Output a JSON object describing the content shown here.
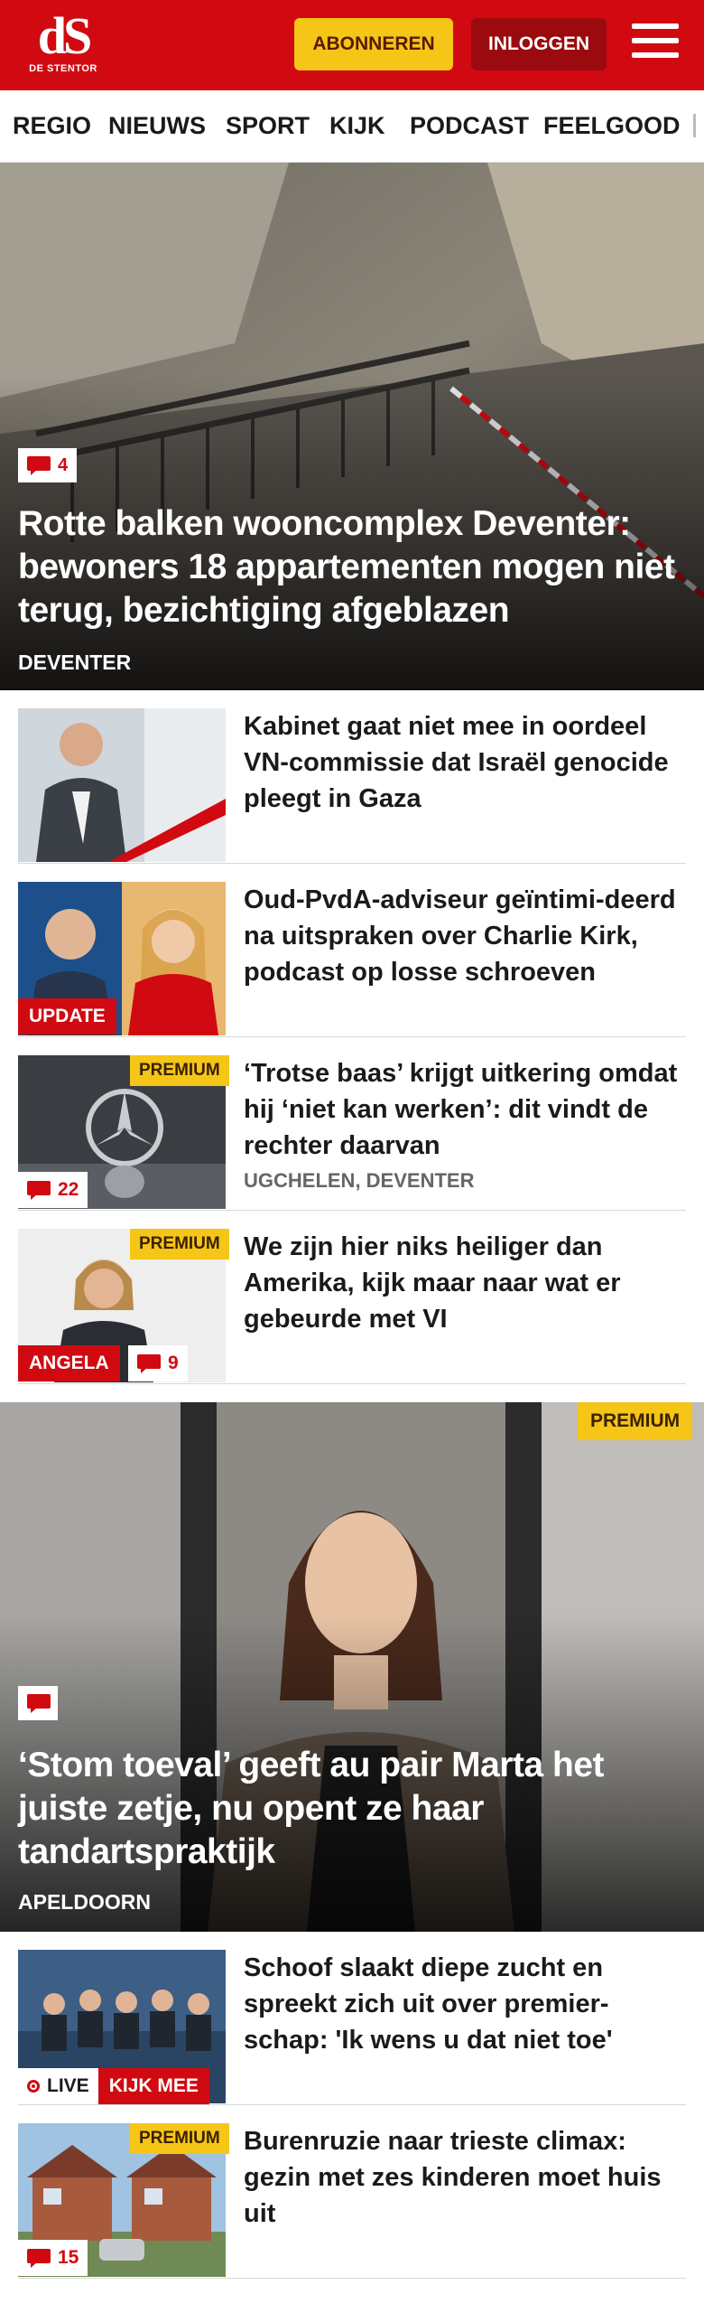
{
  "header": {
    "logo_mark": "dS",
    "logo_sub": "DE STENTOR",
    "subscribe_label": "ABONNEREN",
    "login_label": "INLOGGEN"
  },
  "nav": {
    "items": [
      "REGIO",
      "NIEUWS",
      "SPORT",
      "KIJK",
      "PODCAST",
      "FEELGOOD"
    ]
  },
  "hero1": {
    "comments": "4",
    "title": "Rotte balken wooncomplex Deventer: bewoners 18 appartementen mogen niet terug, bezichtiging afgeblazen",
    "category": "DEVENTER"
  },
  "articles": [
    {
      "title": "Kabinet gaat niet mee in oordeel VN-commissie dat Israël genocide pleegt in Gaza"
    },
    {
      "title": "Oud-PvdA-adviseur geïntimi-deerd na uitspraken over Charlie Kirk, podcast op losse schroeven",
      "label": "UPDATE"
    },
    {
      "title": "‘Trotse baas’ krijgt uitkering omdat hij ‘niet kan werken’: dit vindt de rechter daarvan",
      "category": "UGCHELEN, DEVENTER",
      "premium": "PREMIUM",
      "comments": "22"
    },
    {
      "title": "We zijn hier niks heiliger dan Amerika, kijk maar naar wat er gebeurde met VI",
      "premium": "PREMIUM",
      "label": "ANGELA",
      "comments": "9"
    }
  ],
  "hero2": {
    "premium": "PREMIUM",
    "title": "‘Stom toeval’ geeft au pair Marta het juiste zetje, nu opent ze haar tandartspraktijk",
    "category": "APELDOORN"
  },
  "articles2": [
    {
      "title": "Schoof slaakt diepe zucht en spreekt zich uit over premier-schap: 'Ik wens u dat niet toe'",
      "live": "LIVE",
      "watch": "KIJK MEE"
    },
    {
      "title": "Burenruzie naar trieste climax: gezin met zes kinderen moet huis uit",
      "premium": "PREMIUM",
      "comments": "15"
    }
  ],
  "colors": {
    "brand_red": "#d10a11",
    "premium_yellow": "#f5c518",
    "login_dark_red": "#9b0a0e"
  },
  "icons": [
    "menu-icon",
    "comment-icon",
    "live-icon"
  ]
}
